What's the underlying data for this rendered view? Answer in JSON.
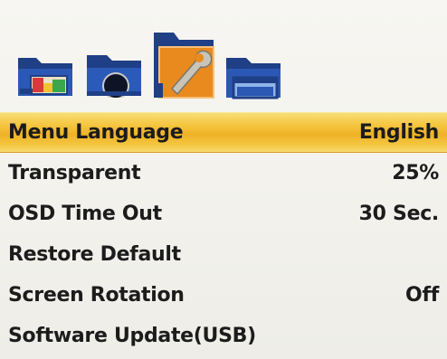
{
  "header": {
    "tabs": [
      {
        "icon": "folder-picture-icon",
        "active": false
      },
      {
        "icon": "folder-circle-icon",
        "active": false
      },
      {
        "icon": "folder-wrench-icon",
        "active": true
      },
      {
        "icon": "folder-window-icon",
        "active": false
      }
    ]
  },
  "menu": {
    "items": [
      {
        "label": "Menu Language",
        "value": "English",
        "selected": true
      },
      {
        "label": "Transparent",
        "value": "25%",
        "selected": false
      },
      {
        "label": "OSD Time Out",
        "value": "30 Sec.",
        "selected": false
      },
      {
        "label": "Restore Default",
        "value": "",
        "selected": false
      },
      {
        "label": "Screen Rotation",
        "value": "Off",
        "selected": false
      },
      {
        "label": "Software Update(USB)",
        "value": "",
        "selected": false
      }
    ]
  },
  "colors": {
    "selection": "#f0b429",
    "folder": "#1f3f86",
    "active_tab": "#e88a1e",
    "text": "#1c1c1c"
  }
}
